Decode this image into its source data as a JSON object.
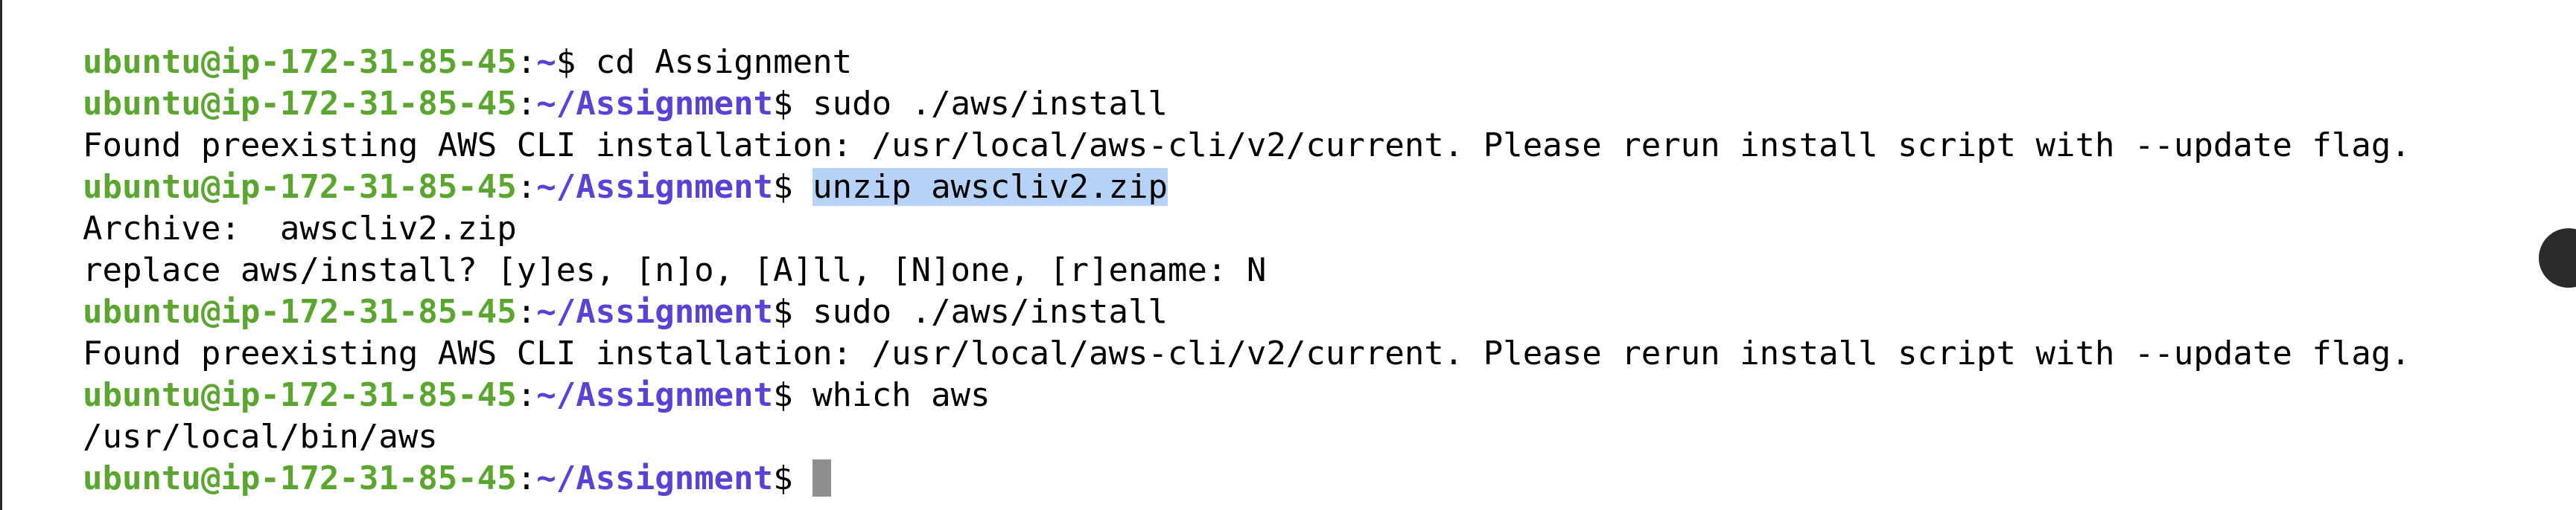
{
  "prompt": {
    "user_host": "ubuntu@ip-172-31-85-45",
    "colon": ":",
    "home_path": "~",
    "assign_path": "~/Assignment",
    "dollar": "$"
  },
  "lines": {
    "l1_cmd": " cd Assignment",
    "l2_cmd": " sudo ./aws/install",
    "l3_out": "Found preexisting AWS CLI installation: /usr/local/aws-cli/v2/current. Please rerun install script with --update flag.",
    "l4_selected_cmd": "unzip awscliv2.zip",
    "l5_out": "Archive:  awscliv2.zip",
    "l6_out": "replace aws/install? [y]es, [n]o, [A]ll, [N]one, [r]ename: N",
    "l7_cmd": " sudo ./aws/install",
    "l8_out": "Found preexisting AWS CLI installation: /usr/local/aws-cli/v2/current. Please rerun install script with --update flag.",
    "l9_cmd": " which aws",
    "l10_out": "/usr/local/bin/aws"
  },
  "colors": {
    "user": "#5aa62e",
    "path": "#5b42d6",
    "selection": "#b7d2f7",
    "cursor": "#8f8f8f"
  }
}
